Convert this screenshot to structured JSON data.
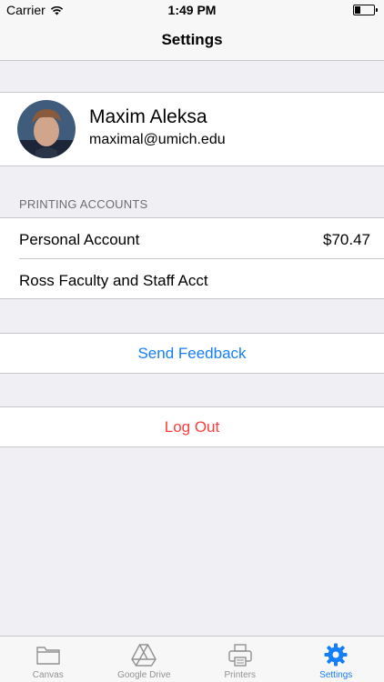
{
  "status_bar": {
    "carrier": "Carrier",
    "time": "1:49 PM",
    "battery_level": 0.35
  },
  "nav": {
    "title": "Settings"
  },
  "profile": {
    "name": "Maxim Aleksa",
    "email": "maximal@umich.edu"
  },
  "printing_accounts": {
    "header": "PRINTING ACCOUNTS",
    "accounts": [
      {
        "label": "Personal Account",
        "value": "$70.47"
      },
      {
        "label": "Ross Faculty and Staff Acct",
        "value": ""
      }
    ]
  },
  "actions": {
    "send_feedback": "Send Feedback",
    "log_out": "Log Out"
  },
  "tabs": [
    {
      "label": "Canvas",
      "icon": "folder-icon",
      "active": false
    },
    {
      "label": "Google Drive",
      "icon": "google-drive-icon",
      "active": false
    },
    {
      "label": "Printers",
      "icon": "printer-icon",
      "active": false
    },
    {
      "label": "Settings",
      "icon": "gear-icon",
      "active": true
    }
  ],
  "colors": {
    "accent": "#157efb",
    "destructive": "#fc3d39",
    "background": "#efeff4"
  }
}
